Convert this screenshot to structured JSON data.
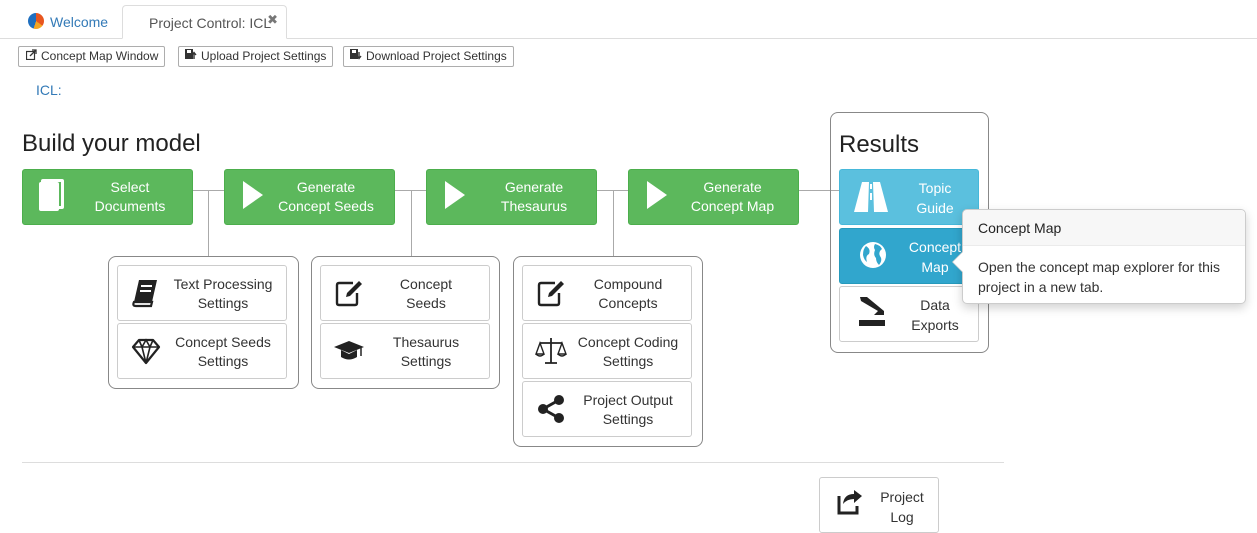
{
  "tabs": {
    "welcome": "Welcome",
    "project": "Project Control: ICL",
    "close_glyph": "✖"
  },
  "toolbar": {
    "concept_map_window": "Concept Map Window",
    "upload_settings": "Upload Project Settings",
    "download_settings": "Download Project Settings"
  },
  "project_label": "ICL:",
  "build": {
    "heading": "Build your model",
    "steps": [
      {
        "line1": "Select",
        "line2": "Documents",
        "icon": "document-icon"
      },
      {
        "line1": "Generate",
        "line2": "Concept Seeds",
        "icon": "play-icon"
      },
      {
        "line1": "Generate",
        "line2": "Thesaurus",
        "icon": "play-icon"
      },
      {
        "line1": "Generate",
        "line2": "Concept Map",
        "icon": "play-icon"
      }
    ],
    "settings": [
      {
        "line1": "Text Processing",
        "line2": "Settings",
        "icon": "book-icon"
      },
      {
        "line1": "Concept Seeds",
        "line2": "Settings",
        "icon": "diamond-icon"
      },
      {
        "line1": "Concept",
        "line2": "Seeds",
        "icon": "edit-icon"
      },
      {
        "line1": "Thesaurus",
        "line2": "Settings",
        "icon": "graduation-cap-icon"
      },
      {
        "line1": "Compound",
        "line2": "Concepts",
        "icon": "edit-icon"
      },
      {
        "line1": "Concept Coding",
        "line2": "Settings",
        "icon": "scales-icon"
      },
      {
        "line1": "Project Output",
        "line2": "Settings",
        "icon": "share-icon"
      }
    ]
  },
  "results": {
    "heading": "Results",
    "items": [
      {
        "line1": "Topic",
        "line2": "Guide",
        "icon": "road-icon"
      },
      {
        "line1": "Concept",
        "line2": "Map",
        "icon": "globe-icon"
      },
      {
        "line1": "Data",
        "line2": "Exports",
        "icon": "download-icon"
      }
    ]
  },
  "tooltip": {
    "title": "Concept Map",
    "body": "Open the concept map explorer for this project in a new tab."
  },
  "project_log": {
    "line1": "Project",
    "line2": "Log",
    "icon": "share-square-icon"
  },
  "colors": {
    "success": "#5cb85c",
    "info": "#5bc0de",
    "info_active": "#31a6cd",
    "link": "#337ab7"
  }
}
